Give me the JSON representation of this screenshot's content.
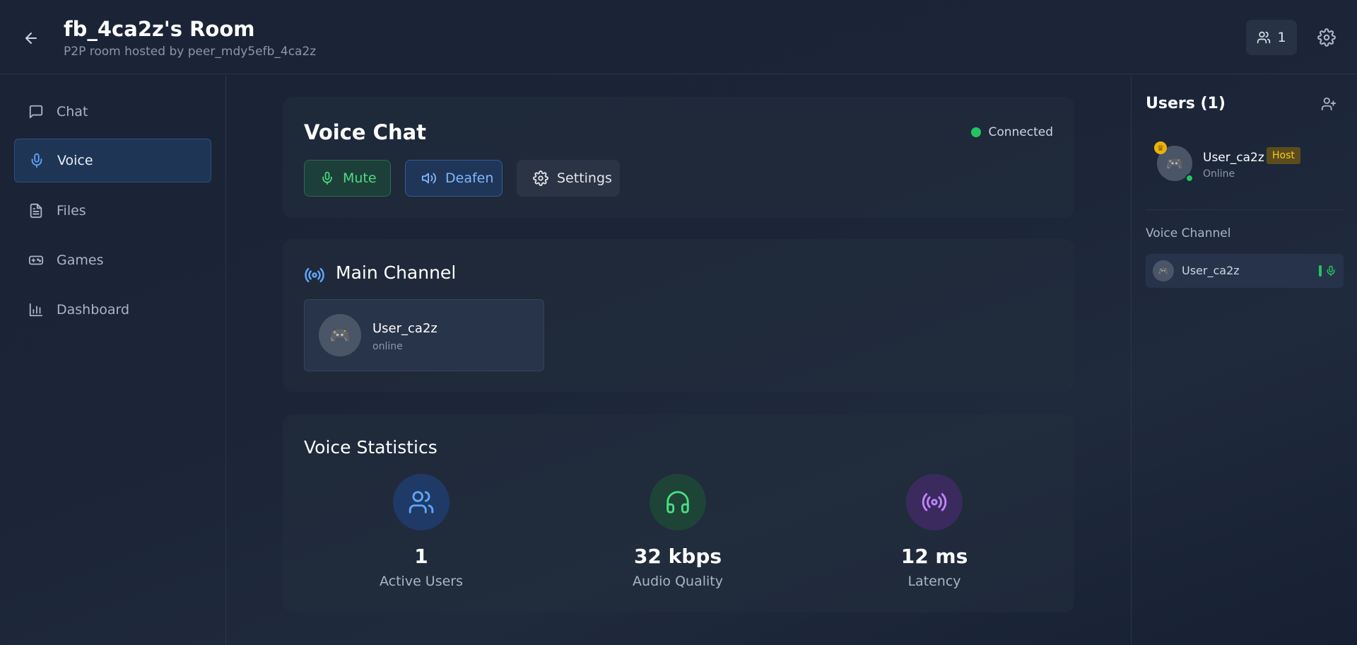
{
  "header": {
    "title": "fb_4ca2z's Room",
    "subtitle": "P2P room hosted by peer_mdy5efb_4ca2z",
    "users_count": "1",
    "back_icon": "arrow-left-icon",
    "settings_icon": "gear-icon"
  },
  "sidebar": {
    "items": [
      {
        "label": "Chat",
        "icon": "message-square-icon",
        "active": false
      },
      {
        "label": "Voice",
        "icon": "microphone-icon",
        "active": true
      },
      {
        "label": "Files",
        "icon": "file-text-icon",
        "active": false
      },
      {
        "label": "Games",
        "icon": "gamepad-icon",
        "active": false
      },
      {
        "label": "Dashboard",
        "icon": "bar-chart-icon",
        "active": false
      }
    ]
  },
  "voice": {
    "title": "Voice Chat",
    "status": "Connected",
    "mute_label": "Mute",
    "deafen_label": "Deafen",
    "settings_label": "Settings"
  },
  "channel": {
    "title": "Main Channel",
    "members": [
      {
        "name": "User_ca2z",
        "status": "online",
        "avatar": "🎮"
      }
    ]
  },
  "stats": {
    "title": "Voice Statistics",
    "items": [
      {
        "value": "1",
        "label": "Active Users",
        "icon": "users-icon",
        "color": "#60a5fa"
      },
      {
        "value": "32 kbps",
        "label": "Audio Quality",
        "icon": "headphones-icon",
        "color": "#4ade80"
      },
      {
        "value": "12 ms",
        "label": "Latency",
        "icon": "radio-icon",
        "color": "#c084fc"
      }
    ]
  },
  "users_panel": {
    "title": "Users (1)",
    "user": {
      "name": "User_ca2z",
      "badge": "Host",
      "status": "Online",
      "avatar": "🎮"
    },
    "voice_channel_label": "Voice Channel",
    "voice_channel_user": "User_ca2z",
    "voice_channel_avatar": "🎮"
  },
  "colors": {
    "accent_blue": "#60a5fa",
    "online_green": "#22c55e",
    "host_gold": "#facc15"
  }
}
